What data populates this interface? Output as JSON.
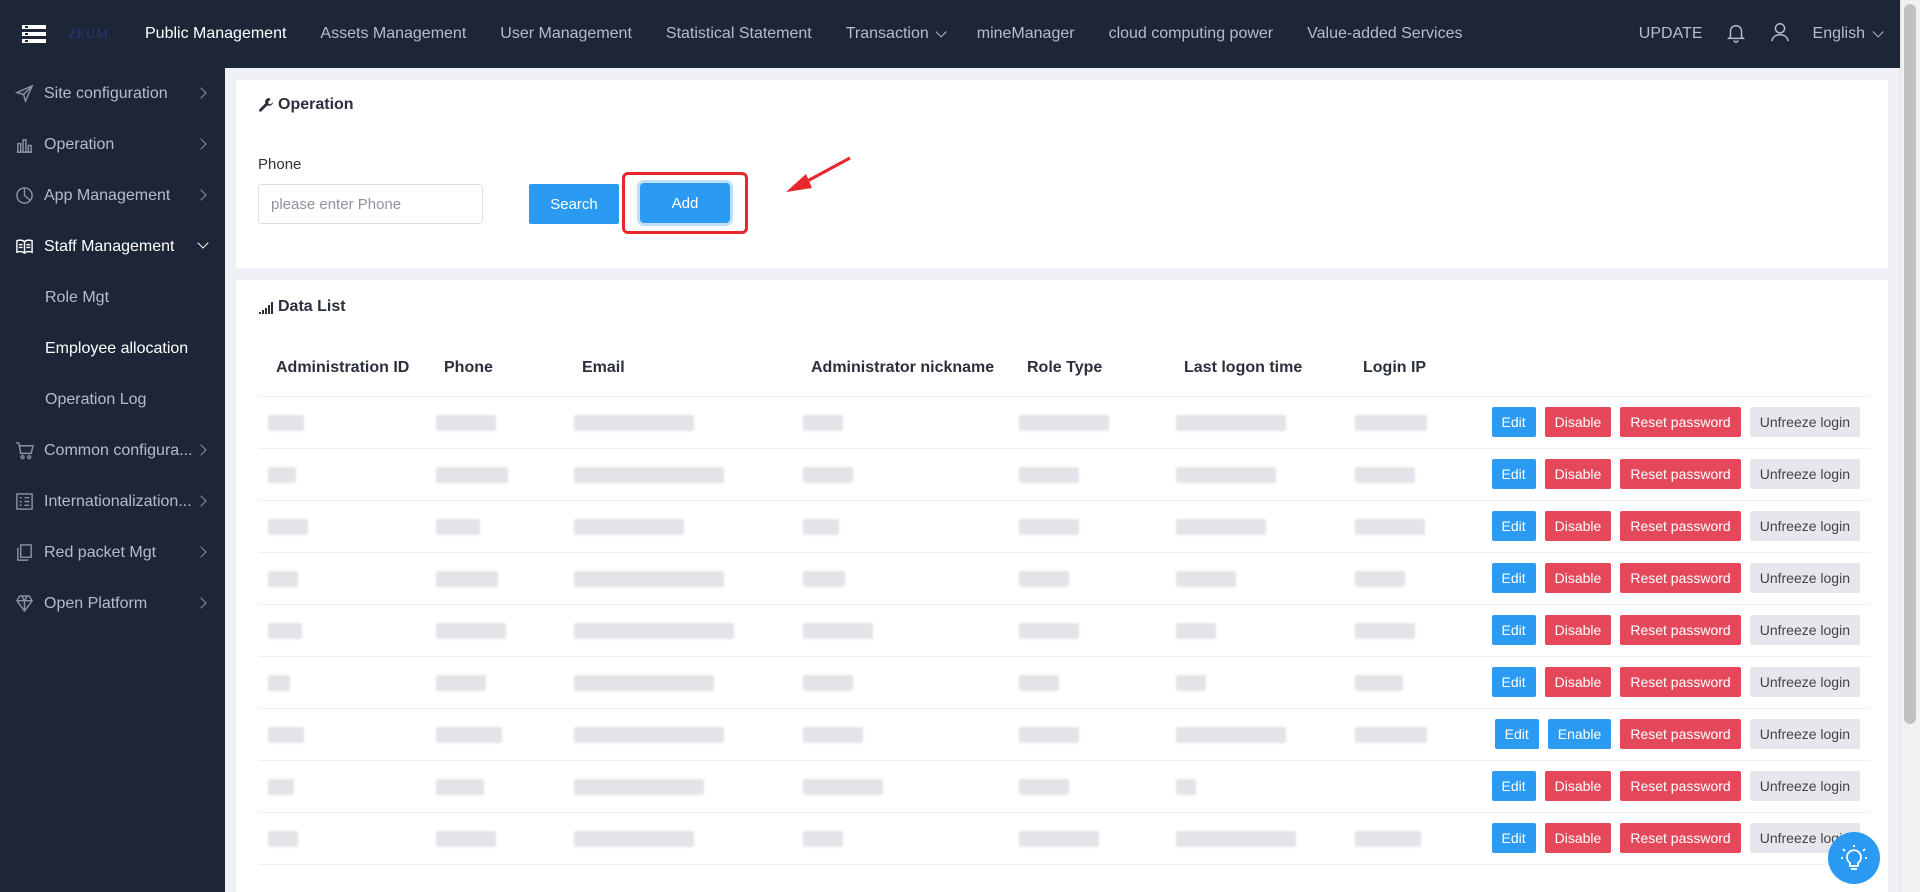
{
  "topbar": {
    "logo": "ZEUM",
    "nav": [
      {
        "label": "Public Management",
        "active": true
      },
      {
        "label": "Assets Management"
      },
      {
        "label": "User Management"
      },
      {
        "label": "Statistical Statement"
      },
      {
        "label": "Transaction",
        "dropdown": true
      },
      {
        "label": "mineManager"
      },
      {
        "label": "cloud computing power"
      },
      {
        "label": "Value-added Services"
      }
    ],
    "update": "UPDATE",
    "language": "English"
  },
  "sidebar": {
    "items": [
      {
        "label": "Site configuration",
        "icon": "send-icon"
      },
      {
        "label": "Operation",
        "icon": "bar-chart-icon"
      },
      {
        "label": "App Management",
        "icon": "pie-chart-icon"
      },
      {
        "label": "Staff Management",
        "icon": "book-icon",
        "open": true
      },
      {
        "label": "Common configura...",
        "icon": "cart-icon"
      },
      {
        "label": "Internationalization...",
        "icon": "grid-icon"
      },
      {
        "label": "Red packet Mgt",
        "icon": "copy-icon"
      },
      {
        "label": "Open Platform",
        "icon": "diamond-icon"
      }
    ],
    "subitems": [
      {
        "label": "Role Mgt"
      },
      {
        "label": "Employee allocation",
        "active": true
      },
      {
        "label": "Operation Log"
      }
    ]
  },
  "operation": {
    "title": "Operation",
    "phone_label": "Phone",
    "phone_placeholder": "please enter Phone",
    "search_label": "Search",
    "add_label": "Add"
  },
  "datalist": {
    "title": "Data List",
    "columns": [
      "Administration ID",
      "Phone",
      "Email",
      "Administrator nickname",
      "Role Type",
      "Last logon time",
      "Login IP"
    ],
    "actions": {
      "edit": "Edit",
      "disable": "Disable",
      "enable": "Enable",
      "reset": "Reset password",
      "unfreeze": "Unfreeze login"
    },
    "row_states": [
      "disable",
      "disable",
      "disable",
      "disable",
      "disable",
      "disable",
      "enable",
      "disable",
      "disable"
    ]
  },
  "colors": {
    "nav_bg": "#1d2637",
    "primary": "#2b9af3",
    "danger": "#e5485a",
    "annotation": "#e8262b"
  }
}
